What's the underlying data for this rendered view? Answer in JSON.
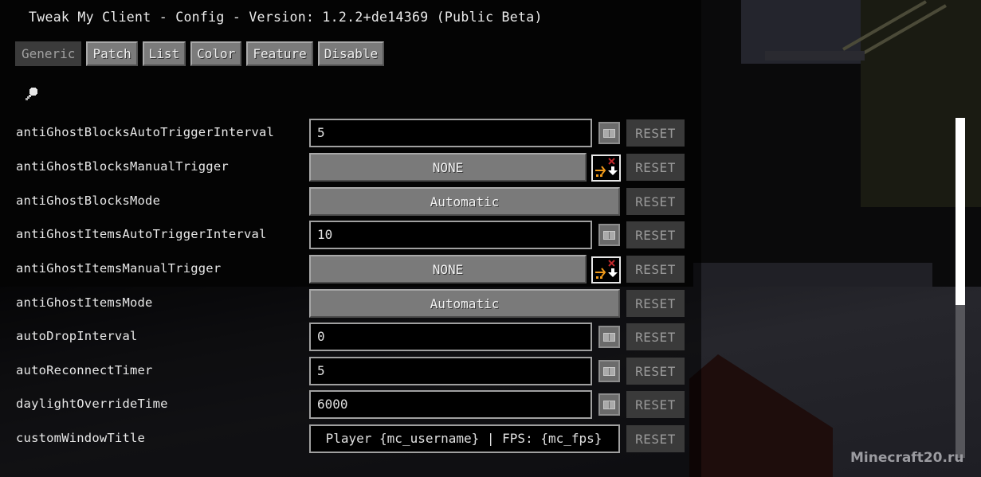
{
  "window": {
    "title": "Tweak My Client - Config - Version: 1.2.2+de14369 (Public Beta)"
  },
  "tabs": [
    {
      "label": "Generic",
      "active": true
    },
    {
      "label": "Patch",
      "active": false
    },
    {
      "label": "List",
      "active": false
    },
    {
      "label": "Color",
      "active": false
    },
    {
      "label": "Feature",
      "active": false
    },
    {
      "label": "Disable",
      "active": false
    }
  ],
  "search": {
    "icon": "search-icon"
  },
  "config_rows": [
    {
      "label": "antiGhostBlocksAutoTriggerInterval",
      "type": "number",
      "value": "5",
      "reset_label": "RESET"
    },
    {
      "label": "antiGhostBlocksManualTrigger",
      "type": "hotkey",
      "value": "NONE",
      "reset_label": "RESET"
    },
    {
      "label": "antiGhostBlocksMode",
      "type": "option",
      "value": "Automatic",
      "reset_label": "RESET"
    },
    {
      "label": "antiGhostItemsAutoTriggerInterval",
      "type": "number",
      "value": "10",
      "reset_label": "RESET"
    },
    {
      "label": "antiGhostItemsManualTrigger",
      "type": "hotkey",
      "value": "NONE",
      "reset_label": "RESET"
    },
    {
      "label": "antiGhostItemsMode",
      "type": "option",
      "value": "Automatic",
      "reset_label": "RESET"
    },
    {
      "label": "autoDropInterval",
      "type": "number",
      "value": "0",
      "reset_label": "RESET"
    },
    {
      "label": "autoReconnectTimer",
      "type": "number",
      "value": "5",
      "reset_label": "RESET"
    },
    {
      "label": "daylightOverrideTime",
      "type": "number",
      "value": "6000",
      "reset_label": "RESET"
    },
    {
      "label": "customWindowTitle",
      "type": "string",
      "value": "Player {mc_username} | FPS: {mc_fps}",
      "reset_label": "RESET"
    }
  ],
  "scrollbar": {
    "thumb_fraction": 0.55,
    "position_fraction": 0.0
  },
  "watermark": "Minecraft20.ru",
  "colors": {
    "reset_text": "#9a9a9a",
    "hotkey_arrow": "#f09a1a",
    "hotkey_cross": "#c0282c"
  }
}
